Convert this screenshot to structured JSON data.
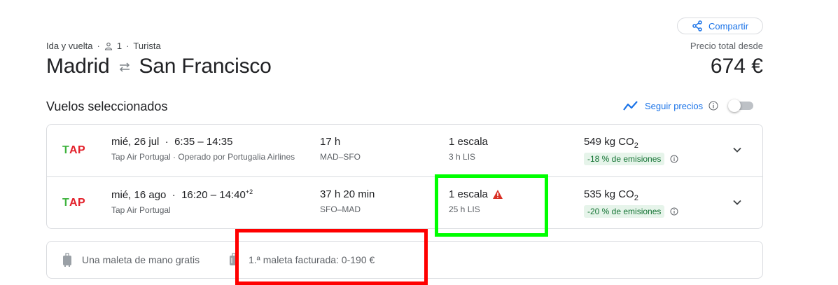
{
  "header": {
    "share_label": "Compartir",
    "trip_type": "Ida y vuelta",
    "passengers": "1",
    "cabin": "Turista",
    "origin": "Madrid",
    "destination": "San Francisco",
    "price_caption": "Precio total desde",
    "price_total": "674 €"
  },
  "selected": {
    "title": "Vuelos seleccionados",
    "track_label": "Seguir precios",
    "track_enabled": false
  },
  "flights": [
    {
      "airline_logo": "TAP",
      "date": "mié, 26 jul",
      "times": "6:35 – 14:35",
      "day_offset": "",
      "airline": "Tap Air Portugal · Operado por Portugalia Airlines",
      "duration": "17 h",
      "route": "MAD–SFO",
      "stops": "1 escala",
      "stop_detail": "3 h LIS",
      "warning": false,
      "co2_value": "549 kg CO",
      "co2_sub": "2",
      "emissions": "-18 % de emisiones"
    },
    {
      "airline_logo": "TAP",
      "date": "mié, 16 ago",
      "times": "16:20 – 14:40",
      "day_offset": "+2",
      "airline": "Tap Air Portugal",
      "duration": "37 h 20 min",
      "route": "SFO–MAD",
      "stops": "1 escala",
      "stop_detail": "25 h LIS",
      "warning": true,
      "co2_value": "535 kg CO",
      "co2_sub": "2",
      "emissions": "-20 % de emisiones"
    }
  ],
  "baggage": {
    "carry_on": "Una maleta de mano gratis",
    "checked": "1.ª maleta facturada: 0-190 €"
  },
  "colors": {
    "accent": "#1a73e8",
    "emissions_bg": "#e6f4ea",
    "emissions_text": "#137333",
    "warning": "#d93025",
    "highlight_green": "#00ff00",
    "highlight_red": "#ff0000"
  },
  "icons": {
    "share": "share-icon",
    "person": "person-icon",
    "swap": "swap-arrows-icon",
    "trend": "trend-chart-icon",
    "info": "info-icon",
    "warning": "warning-icon",
    "chevron": "chevron-down-icon",
    "luggage": "luggage-icon"
  }
}
